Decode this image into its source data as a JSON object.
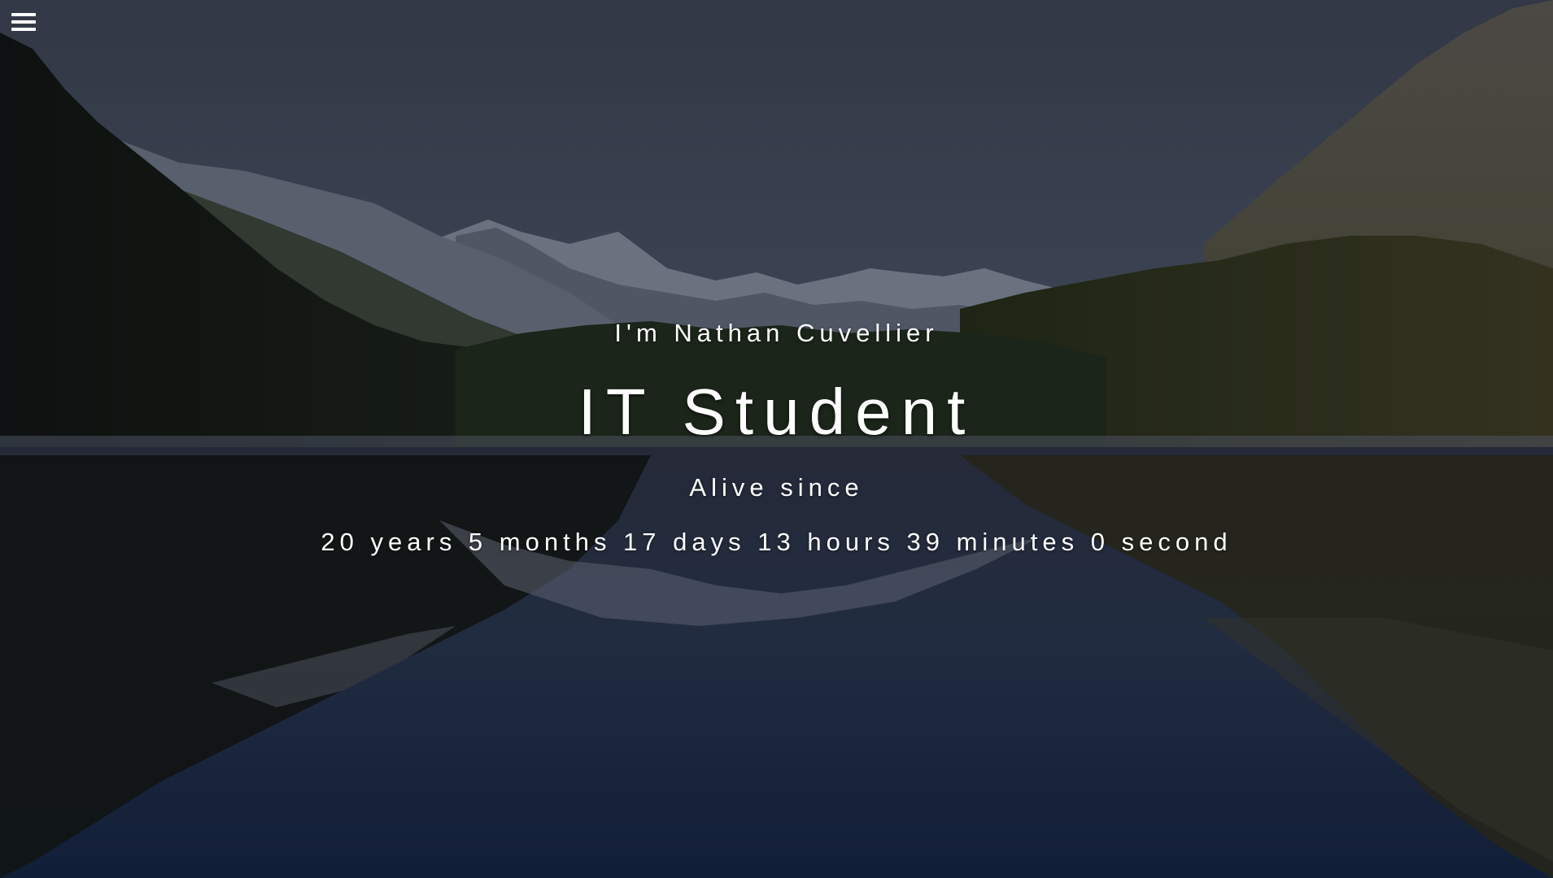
{
  "header": {
    "menu_icon": "hamburger-menu-icon"
  },
  "hero": {
    "background": "mountain-lake-reflection-photo",
    "intro": "I'm Nathan Cuvellier",
    "role": "IT Student",
    "alive_label": "Alive since",
    "age_counter": "20 years 5 months 17 days 13 hours 39 minutes 0 second"
  },
  "colors": {
    "text": "#ffffff",
    "sky": "#3e4556",
    "water": "#1c2a44"
  }
}
